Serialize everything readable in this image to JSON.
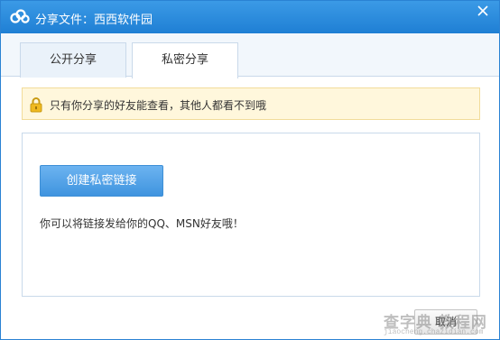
{
  "window": {
    "title": "分享文件：西西软件园",
    "logo_icon": "cloud-share-icon",
    "close_icon": "close-icon"
  },
  "tabs": [
    {
      "label": "公开分享",
      "active": false
    },
    {
      "label": "私密分享",
      "active": true
    }
  ],
  "notice": {
    "icon": "lock-icon",
    "text": "只有你分享的好友能查看，其他人都看不到哦"
  },
  "panel": {
    "create_button_label": "创建私密链接",
    "hint": "你可以将链接发给你的QQ、MSN好友哦！"
  },
  "footer": {
    "cancel_label": "取消"
  },
  "watermark": {
    "main": "查字典 教程网",
    "sub": "jiaocheng.chazidian.com"
  },
  "colors": {
    "titlebar": "#1f7fd4",
    "accent_button": "#4a9ce4",
    "notice_bg": "#fff7dc",
    "border": "#c9d9ea"
  }
}
